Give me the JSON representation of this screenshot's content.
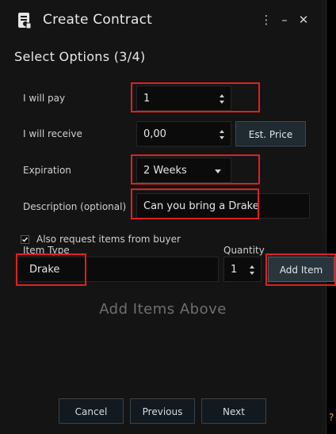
{
  "window": {
    "title": "Create Contract",
    "menu_glyph": "⋮",
    "minimize_glyph": "–",
    "close_glyph": "✕"
  },
  "heading": "Select Options (3/4)",
  "pay": {
    "label": "I will pay",
    "value": "1"
  },
  "receive": {
    "label": "I will receive",
    "value": "0,00",
    "est_price_label": "Est. Price"
  },
  "expiration": {
    "label": "Expiration",
    "value": "2 Weeks"
  },
  "description": {
    "label": "Description (optional)",
    "value": "Can you bring a Drake"
  },
  "request_items": {
    "label": "Also request items from buyer",
    "checked": true
  },
  "item_type": {
    "label": "Item Type",
    "value": "Drake"
  },
  "quantity": {
    "label": "Quantity",
    "value": "1"
  },
  "add_item_label": "Add Item",
  "empty_note": "Add Items Above",
  "footer": {
    "cancel": "Cancel",
    "previous": "Previous",
    "next": "Next"
  },
  "edge_glyph": "?",
  "colors": {
    "highlight": "#e02020",
    "window_bg": "#141414",
    "field_bg": "#0b0b0b",
    "accent_button": "#1f2a31"
  },
  "icons": [
    "contract-icon",
    "menu-icon",
    "minimize-icon",
    "close-icon",
    "spin-icon",
    "chevron-down-icon",
    "checkbox-icon"
  ]
}
